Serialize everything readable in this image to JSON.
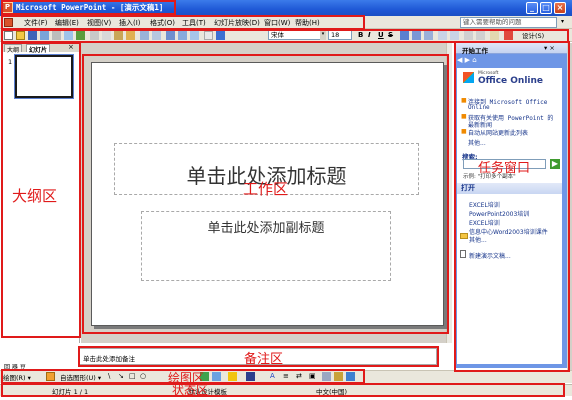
{
  "window": {
    "app_icon": "P",
    "title": "Microsoft PowerPoint - [演示文稿1]",
    "buttons": {
      "minimize": "_",
      "maximize": "□",
      "close": "×"
    }
  },
  "menu": {
    "items": [
      "文件(F)",
      "编辑(E)",
      "视图(V)",
      "插入(I)",
      "格式(O)",
      "工具(T)",
      "幻灯片放映(D)",
      "窗口(W)",
      "帮助(H)"
    ],
    "help_placeholder": "键入需要帮助的问题",
    "help_arrow": "▾"
  },
  "toolbar": {
    "font_name": "宋体",
    "font_arrow": "▾",
    "font_size": "18",
    "bold": "B",
    "italic": "I",
    "underline": "U",
    "strikethrough": "S",
    "design": "设计(S)"
  },
  "outline_pane": {
    "tabs": [
      "大纲",
      "幻灯片"
    ],
    "close": "×",
    "slide_number": "1",
    "annotation": "大纲区"
  },
  "slide": {
    "title_placeholder": "单击此处添加标题",
    "subtitle_placeholder": "单击此处添加副标题",
    "annotation": "工作区"
  },
  "notes": {
    "placeholder": "单击此处添加备注",
    "annotation": "备注区"
  },
  "view_buttons": "回 器 豆",
  "draw_toolbar": {
    "draw": "绘图(R) ▾",
    "autoshapes": "自选图形(U) ▾",
    "annotation": "绘图区",
    "tools": [
      "\\",
      "↘",
      "□",
      "○",
      "A",
      "≡",
      "⇄",
      "▣"
    ]
  },
  "status": {
    "slide": "幻灯片 1 / 1",
    "template": "默认设计模板",
    "language": "中文(中国)",
    "annotation": "状态区"
  },
  "task_pane": {
    "title": "开始工作",
    "header_controls": "▾ ×",
    "nav": "◀ ▶ ⌂",
    "office_microsoft": "Microsoft",
    "office_online": "Office Online",
    "links": [
      "连接到 Microsoft Office",
      "Online",
      "获取有关使用 PowerPoint 的",
      "最新新闻",
      "自动从网站更新此列表"
    ],
    "more": "其他...",
    "search_head": "搜索:",
    "search_go": "▶",
    "example": "示例: \"打印多个副本\"",
    "annotation": "任务窗口",
    "open_head": "打开",
    "files": [
      "EXCEL培训",
      "PowerPoint2003培训",
      "EXCEL培训",
      "信息中心Word2003培训课件",
      "其他..."
    ],
    "new_presentation": "新建演示文稿..."
  }
}
